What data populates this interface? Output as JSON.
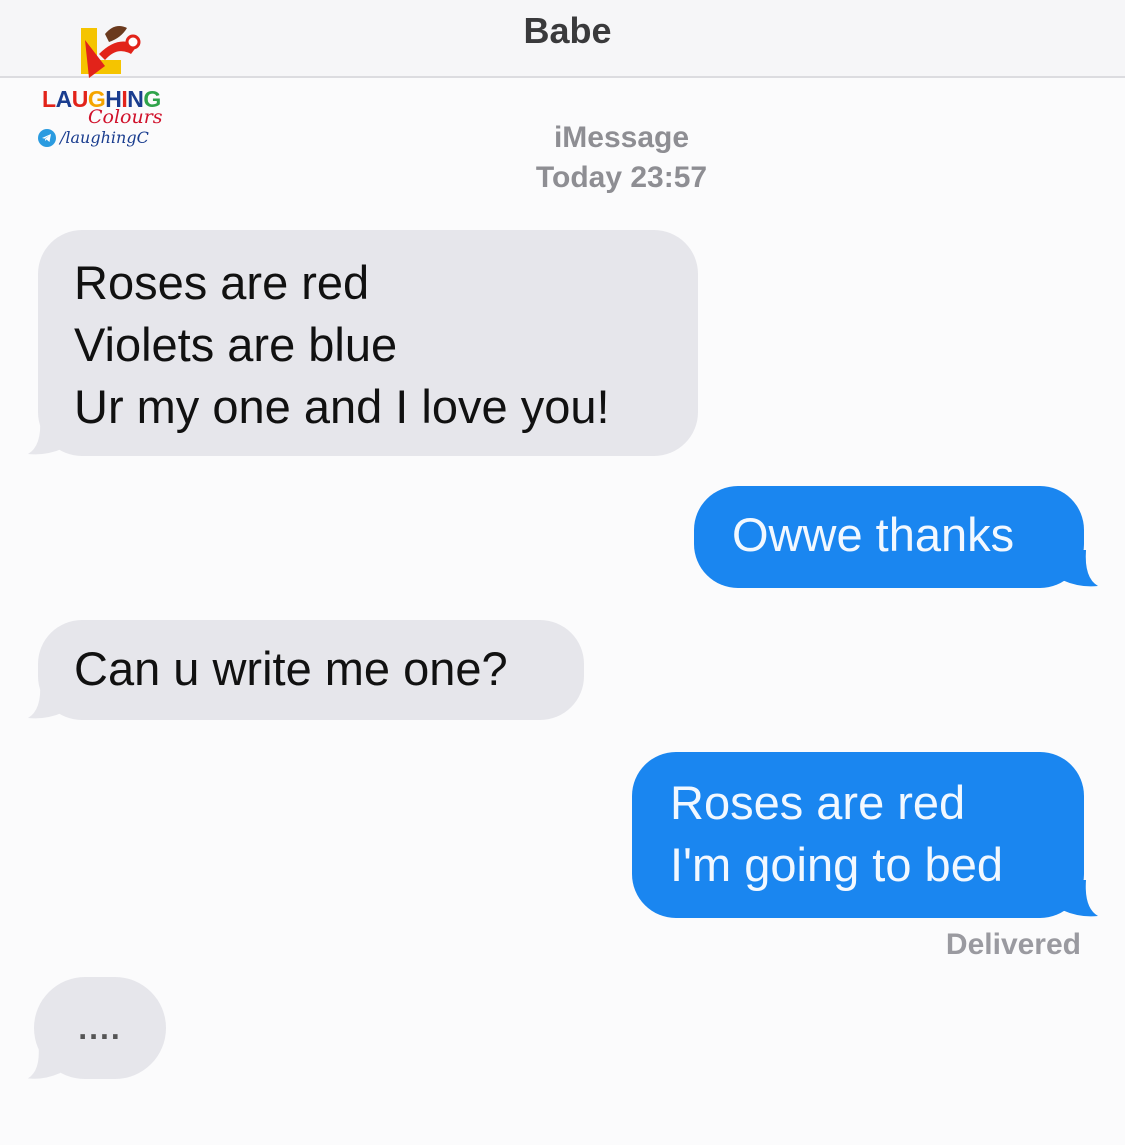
{
  "header": {
    "contact_name": "Babe"
  },
  "watermark": {
    "brand_line1": "LAUGHING",
    "brand_line2": "Colours",
    "handle": "/laughingC",
    "icon": "telegram-icon"
  },
  "thread": {
    "service": "iMessage",
    "timestamp": "Today 23:57",
    "status": "Delivered"
  },
  "messages": [
    {
      "direction": "received",
      "lines": [
        "Roses are red",
        "Violets are blue",
        "Ur my one and I love you!"
      ]
    },
    {
      "direction": "sent",
      "lines": [
        "Owwe thanks"
      ]
    },
    {
      "direction": "received",
      "lines": [
        "Can u write me one?"
      ]
    },
    {
      "direction": "sent",
      "lines": [
        "Roses are red",
        "I'm going to bed"
      ]
    }
  ],
  "typing_indicator": "....",
  "colors": {
    "sent_bubble": "#1a86f0",
    "received_bubble": "#e6e6eb"
  }
}
